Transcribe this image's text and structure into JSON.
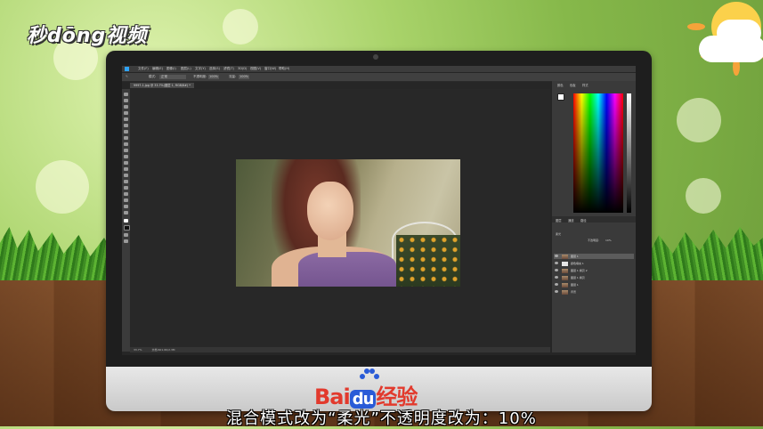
{
  "watermark": {
    "brand": "秒dōng视频"
  },
  "photoshop": {
    "menu": [
      "文件(F)",
      "编辑(E)",
      "图像(I)",
      "图层(L)",
      "文字(Y)",
      "选择(S)",
      "滤镜(T)",
      "3D(D)",
      "视图(V)",
      "窗口(W)",
      "帮助(H)"
    ],
    "options": {
      "mode_label": "模式:",
      "mode_value": "正常",
      "opacity_label": "不透明度:",
      "opacity_value": "100%",
      "flow_label": "流量:",
      "flow_value": "100%"
    },
    "document_tab": "9997-1.jpg @ 33.7%(图层 1, RGB/8#) *",
    "status": {
      "zoom": "33.7%",
      "doc": "文档:601.6K/2.3M"
    },
    "panels": {
      "color_tabs": [
        "颜色",
        "色板",
        "样式"
      ],
      "layers_tabs": [
        "图层",
        "通道",
        "路径"
      ],
      "blend_mode": "柔光",
      "opacity_label": "不透明度:",
      "opacity_value": "10%",
      "layers": [
        {
          "name": "图层 1",
          "selected": true
        },
        {
          "name": "颜色填充 1",
          "selected": false
        },
        {
          "name": "图层 1 拷贝 2",
          "selected": false
        },
        {
          "name": "图层 1 拷贝",
          "selected": false
        },
        {
          "name": "图层 1",
          "selected": false
        },
        {
          "name": "背景",
          "selected": false
        }
      ]
    }
  },
  "monitor_brand": {
    "bai": "Bai",
    "du": "du",
    "cn": "经验"
  },
  "subtitle": "混合模式改为“柔光”不透明度改为：10%"
}
